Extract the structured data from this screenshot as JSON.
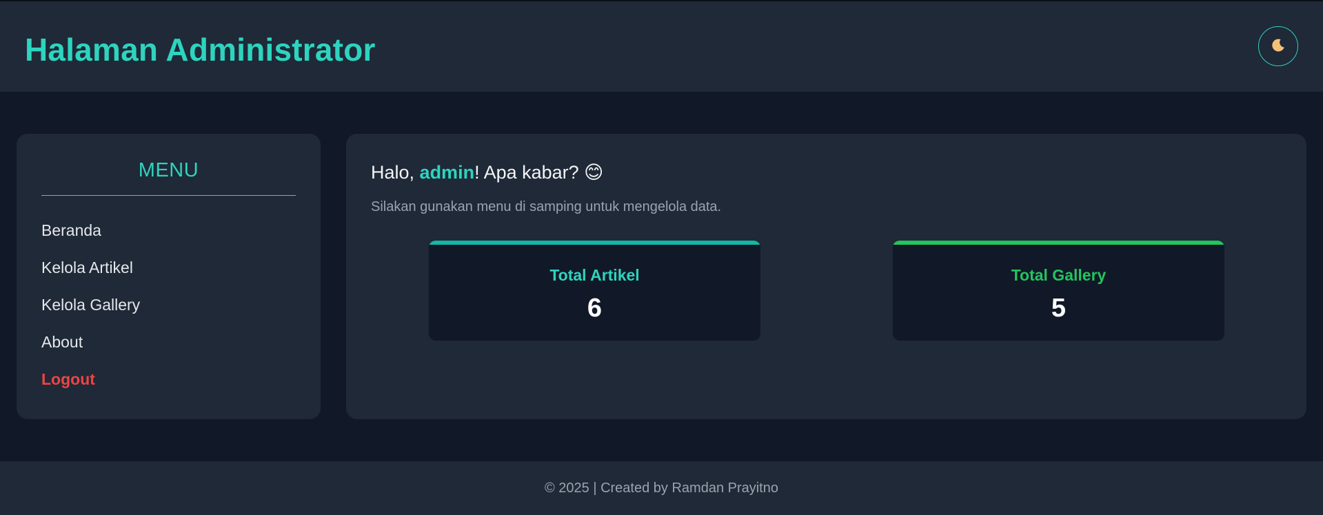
{
  "header": {
    "title": "Halaman Administrator",
    "theme_toggle_icon": "moon-icon"
  },
  "sidebar": {
    "title": "MENU",
    "items": [
      {
        "label": "Beranda"
      },
      {
        "label": "Kelola Artikel"
      },
      {
        "label": "Kelola Gallery"
      },
      {
        "label": "About"
      },
      {
        "label": "Logout"
      }
    ]
  },
  "main": {
    "greeting_prefix": "Halo, ",
    "username": "admin",
    "greeting_suffix": "! Apa kabar? 😊",
    "subtext": "Silakan gunakan menu di samping untuk mengelola data.",
    "stats": [
      {
        "label": "Total Artikel",
        "value": "6",
        "color": "#2dd4bf",
        "accent": "#14b8a6"
      },
      {
        "label": "Total Gallery",
        "value": "5",
        "color": "#22c55e",
        "accent": "#22c55e"
      }
    ]
  },
  "footer": {
    "text": "© 2025 | Created by Ramdan Prayitno"
  },
  "colors": {
    "accent": "#2dd4bf",
    "danger": "#ef4444",
    "surface": "#1f2937",
    "background": "#111827"
  }
}
